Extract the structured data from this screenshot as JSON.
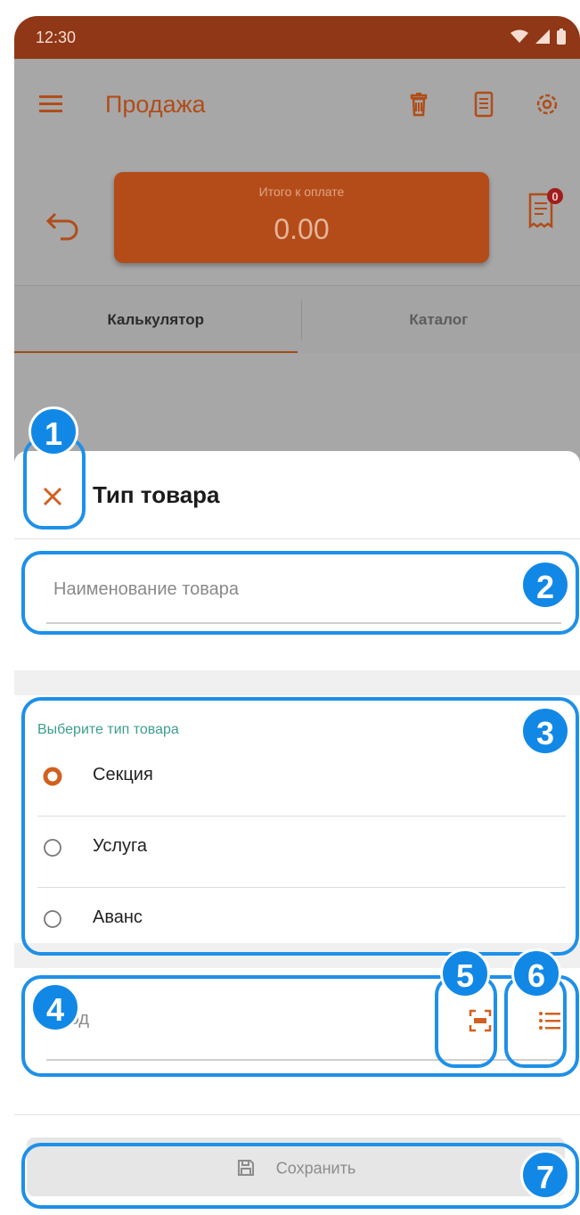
{
  "status_bar": {
    "time": "12:30"
  },
  "app_bar": {
    "title": "Продажа",
    "icons": [
      "menu-icon",
      "trash-icon",
      "document-icon",
      "settings-icon"
    ]
  },
  "total": {
    "label": "Итого к оплате",
    "value": "0.00",
    "receipt_badge": "0"
  },
  "tabs": [
    {
      "label": "Калькулятор",
      "active": true
    },
    {
      "label": "Каталог",
      "active": false
    }
  ],
  "sheet": {
    "title": "Тип товара",
    "name_placeholder": "Наименование товара",
    "type_group_label": "Выберите тип товара",
    "options": [
      {
        "label": "Секция",
        "selected": true
      },
      {
        "label": "Услуга",
        "selected": false
      },
      {
        "label": "Аванс",
        "selected": false
      }
    ],
    "code_placeholder": "Код",
    "save_label": "Сохранить"
  },
  "markers": [
    "1",
    "2",
    "3",
    "4",
    "5",
    "6",
    "7"
  ],
  "colors": {
    "accent": "#b44c19",
    "status": "#8f3716",
    "callout": "#1288e6",
    "group_label": "#3c9e8e"
  }
}
